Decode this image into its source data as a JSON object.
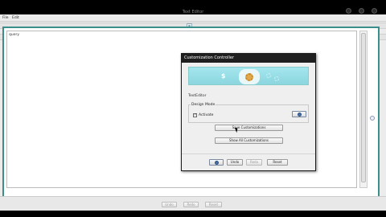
{
  "window": {
    "title": "Text Editor"
  },
  "menu": {
    "file": "File",
    "edit": "Edit"
  },
  "editor": {
    "content": "query"
  },
  "bottom_buttons": {
    "undo": "Undo",
    "redo": "Redo",
    "reset": "Reset"
  },
  "dialog": {
    "title": "Customization Controller",
    "banner_symbol": "$",
    "section_label": "TextEditor",
    "group_legend": "Design Mode",
    "activate_label": "Activate",
    "activate_checked": "✓",
    "save_label": "Save Customizations",
    "show_all_label": "Show All Customizations",
    "undo_label": "Undo",
    "redo_label": "Redo",
    "reset_label": "Reset"
  },
  "colors": {
    "frame_accent": "#3b8f8b",
    "banner": "#9cdfe7",
    "title_bar": "#1f1f1f"
  }
}
